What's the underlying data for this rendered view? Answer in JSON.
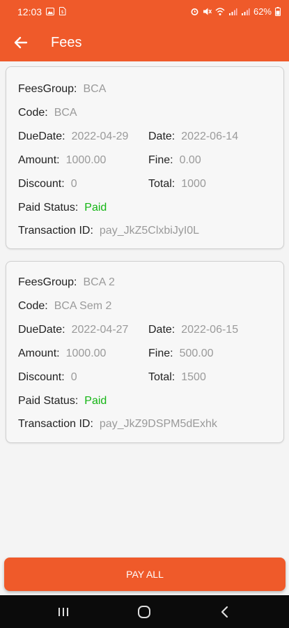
{
  "status_bar": {
    "time": "12:03",
    "battery": "62%"
  },
  "app_bar": {
    "title": "Fees"
  },
  "labels": {
    "fees_group": "FeesGroup:",
    "code": "Code:",
    "due_date": "DueDate:",
    "date": "Date:",
    "amount": "Amount:",
    "fine": "Fine:",
    "discount": "Discount:",
    "total": "Total:",
    "paid_status": "Paid Status:",
    "transaction_id": "Transaction ID:"
  },
  "fees": [
    {
      "fees_group": "BCA",
      "code": "BCA",
      "due_date": "2022-04-29",
      "date": "2022-06-14",
      "amount": "1000.00",
      "fine": "0.00",
      "discount": "0",
      "total": "1000",
      "paid_status": "Paid",
      "transaction_id": "pay_JkZ5ClxbiJyI0L"
    },
    {
      "fees_group": "BCA 2",
      "code": "BCA Sem 2",
      "due_date": "2022-04-27",
      "date": "2022-06-15",
      "amount": "1000.00",
      "fine": "500.00",
      "discount": "0",
      "total": "1500",
      "paid_status": "Paid",
      "transaction_id": "pay_JkZ9DSPM5dExhk"
    }
  ],
  "pay_button": {
    "label": "PAY ALL"
  },
  "colors": {
    "primary": "#ef5a2a",
    "paid": "#13b513",
    "value_text": "#9a9a9a"
  }
}
